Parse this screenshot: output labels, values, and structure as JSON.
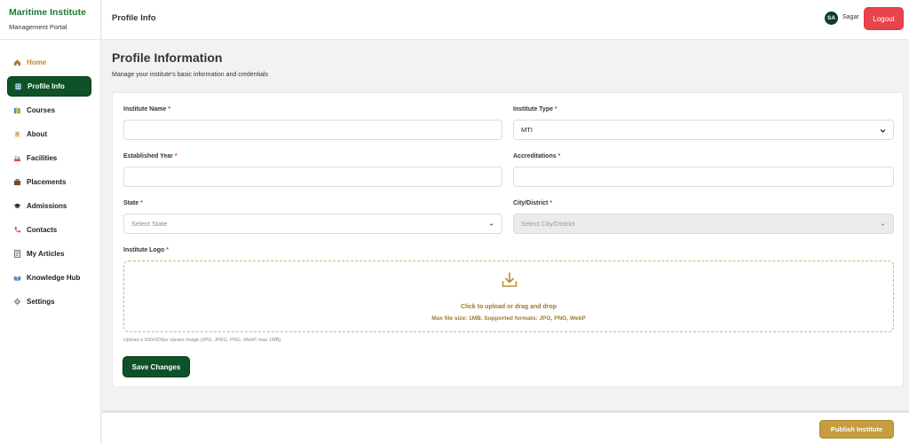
{
  "brand": {
    "title": "Maritime Institute",
    "subtitle": "Management Portal"
  },
  "sidebar": {
    "items": [
      {
        "label": "Home",
        "icon": "home-icon"
      },
      {
        "label": "Profile Info",
        "icon": "building-icon"
      },
      {
        "label": "Courses",
        "icon": "books-icon"
      },
      {
        "label": "About",
        "icon": "scroll-icon"
      },
      {
        "label": "Facilities",
        "icon": "facilities-icon"
      },
      {
        "label": "Placements",
        "icon": "briefcase-icon"
      },
      {
        "label": "Admissions",
        "icon": "graduation-cap-icon"
      },
      {
        "label": "Contacts",
        "icon": "phone-icon"
      },
      {
        "label": "My Articles",
        "icon": "document-icon"
      },
      {
        "label": "Knowledge Hub",
        "icon": "book-icon"
      },
      {
        "label": "Settings",
        "icon": "gear-icon"
      }
    ],
    "active_index": 1
  },
  "topbar": {
    "title": "Profile Info",
    "avatar_initials": "SA",
    "user_name": "Sagar",
    "logout_label": "Logout"
  },
  "page": {
    "title": "Profile Information",
    "subtitle": "Manage your institute's basic information and credentials"
  },
  "form": {
    "institute_name": {
      "label": "Institute Name",
      "value": ""
    },
    "institute_type": {
      "label": "Institute Type",
      "value": "MTI"
    },
    "established_year": {
      "label": "Established Year",
      "value": ""
    },
    "accreditations": {
      "label": "Accreditations",
      "value": ""
    },
    "state": {
      "label": "State",
      "placeholder": "Select State"
    },
    "city": {
      "label": "City/District",
      "placeholder": "Select City/District"
    },
    "logo": {
      "label": "Institute Logo",
      "upload_text": "Click to upload or drag and drop",
      "upload_hint": "Max file size: 1MB. Supported formats: JPG, PNG, WebP",
      "help": "Upload a 500x500px square image (JPG, JPEG, PNG, WebP, max 1MB)."
    },
    "required_marker": "*",
    "save_label": "Save Changes"
  },
  "footer": {
    "publish_label": "Publish Institute"
  },
  "colors": {
    "primary_green": "#0e5228",
    "brand_green": "#1c7a36",
    "gold": "#c59d3f",
    "danger": "#e9434b"
  }
}
